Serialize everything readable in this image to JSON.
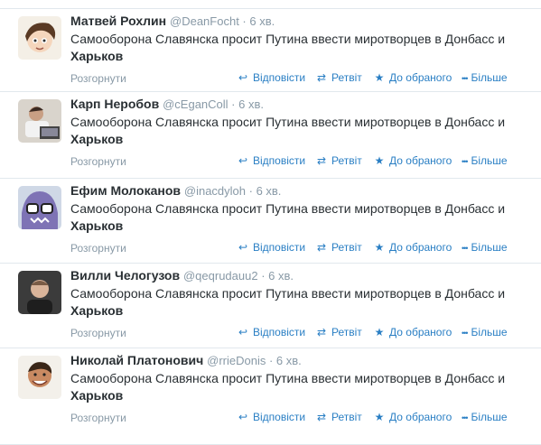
{
  "tweets": [
    {
      "name": "Матвей Рохлин",
      "handle": "@DeanFocht",
      "time": "6 хв.",
      "text_line1": "Самооборона Славянска просит Путина ввести миротворцев в Донбасс и",
      "text_line2": "Харьков",
      "avatar": "avatar-cartoon-boy"
    },
    {
      "name": "Карп Неробов",
      "handle": "@cEganColl",
      "time": "6 хв.",
      "text_line1": "Самооборона Славянска просит Путина ввести миротворцев в Донбасс и",
      "text_line2": "Харьков",
      "avatar": "avatar-man-laptop"
    },
    {
      "name": "Ефим Молоканов",
      "handle": "@inacdyloh",
      "time": "6 хв.",
      "text_line1": "Самооборона Славянска просит Путина ввести миротворцев в Донбасс и",
      "text_line2": "Харьков",
      "avatar": "avatar-monster-glasses"
    },
    {
      "name": "Вилли Челогузов",
      "handle": "@qeqrudauu2",
      "time": "6 хв.",
      "text_line1": "Самооборона Славянска просит Путина ввести миротворцев в Донбасс и",
      "text_line2": "Харьков",
      "avatar": "avatar-man-dark"
    },
    {
      "name": "Николай Платонович",
      "handle": "@rrieDonis",
      "time": "6 хв.",
      "text_line1": "Самооборона Славянска просит Путина ввести миротворцев в Донбасс и",
      "text_line2": "Харьков",
      "avatar": "avatar-man-smiling"
    }
  ],
  "labels": {
    "expand": "Розгорнути",
    "reply": "Відповісти",
    "retweet": "Ретвіт",
    "favorite": "До обраного",
    "more": "Більше"
  },
  "colors": {
    "link": "#2a7fc4",
    "muted": "#8899a6",
    "text": "#292f33"
  }
}
